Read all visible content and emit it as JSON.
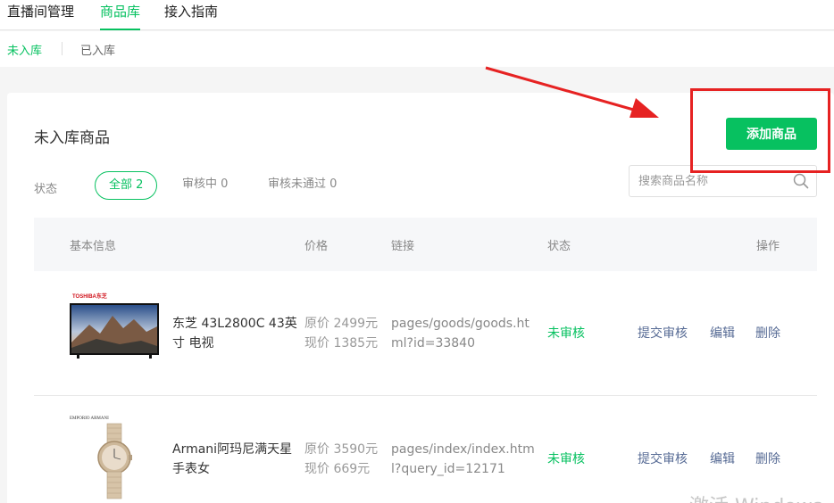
{
  "top_nav": {
    "tabs": [
      "直播间管理",
      "商品库",
      "接入指南"
    ],
    "active": "商品库"
  },
  "sub_nav": {
    "tabs": [
      "未入库",
      "已入库"
    ],
    "active": "未入库"
  },
  "card": {
    "title": "未入库商品",
    "add_button": "添加商品",
    "status_label": "状态",
    "filters": [
      {
        "label": "全部 2",
        "active": true
      },
      {
        "label": "审核中 0",
        "active": false
      },
      {
        "label": "审核未通过 0",
        "active": false
      }
    ],
    "search": {
      "placeholder": "搜索商品名称",
      "value": ""
    }
  },
  "table": {
    "headers": {
      "info": "基本信息",
      "price": "价格",
      "link": "链接",
      "status": "状态",
      "actions": "操作"
    },
    "rows": [
      {
        "name": "东芝 43L2800C 43英寸 电视",
        "original_price": "原价 2499元",
        "current_price": "现价 1385元",
        "link": "pages/goods/goods.html?id=33840",
        "status": "未审核",
        "actions": [
          "提交审核",
          "编辑",
          "删除"
        ],
        "brand_label": "TOSHIBA东芝",
        "thumbnail_icon": "tv-product-image"
      },
      {
        "name": "Armani阿玛尼满天星手表女",
        "original_price": "原价 3590元",
        "current_price": "现价 669元",
        "link": "pages/index/index.html?query_id=12171",
        "status": "未审核",
        "actions": [
          "提交审核",
          "编辑",
          "删除"
        ],
        "brand_label": "EMPORIO ARMANI",
        "thumbnail_icon": "watch-product-image"
      }
    ]
  },
  "watermark": "激活 Windows",
  "colors": {
    "accent": "#07c160",
    "action_link": "#576b95",
    "annotation": "#e62222"
  }
}
